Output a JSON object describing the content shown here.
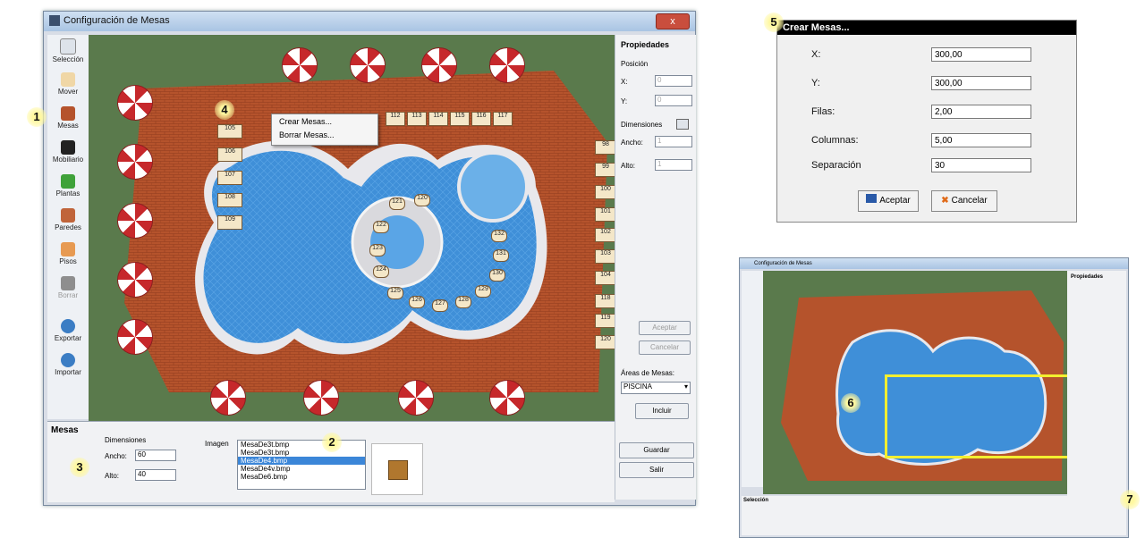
{
  "main_window": {
    "title": "Configuración de Mesas",
    "close_label": "x",
    "tools": [
      "Selección",
      "Mover",
      "Mesas",
      "Mobiliario",
      "Plantas",
      "Paredes",
      "Pisos",
      "Borrar",
      "Exportar",
      "Importar"
    ],
    "context_menu": [
      "Crear Mesas...",
      "Borrar Mesas..."
    ],
    "tables_top": [
      "112",
      "113",
      "114",
      "115",
      "116",
      "117"
    ],
    "tables_left": [
      "105",
      "106",
      "107",
      "108",
      "109"
    ],
    "tables_right": [
      "98",
      "99",
      "100",
      "101",
      "102",
      "103",
      "104",
      "118",
      "119",
      "120"
    ],
    "pool_tables": [
      "121",
      "120",
      "122",
      "123",
      "124",
      "125",
      "126",
      "127",
      "128",
      "129",
      "130",
      "131",
      "132"
    ],
    "properties": {
      "header": "Propiedades",
      "position_label": "Posición",
      "x_label": "X:",
      "x_value": "0",
      "y_label": "Y:",
      "y_value": "0",
      "dimensions_label": "Dimensiones",
      "width_label": "Ancho:",
      "width_value": "1",
      "height_label": "Alto:",
      "height_value": "1",
      "accept_label": "Aceptar",
      "cancel_label": "Cancelar",
      "areas_label": "Áreas de Mesas:",
      "area_selected": "PISCINA",
      "include_label": "Incluir",
      "save_label": "Guardar",
      "exit_label": "Salir"
    },
    "bottom_panel": {
      "title": "Mesas",
      "dimensions_label": "Dimensiones",
      "width_label": "Ancho:",
      "width_value": "60",
      "height_label": "Alto:",
      "height_value": "40",
      "image_label": "Imagen",
      "images": [
        "MesaDe3t.bmp",
        "MesaDe3t.bmp",
        "MesaDe4.bmp",
        "MesaDe4v.bmp",
        "MesaDe6.bmp"
      ],
      "selected_image_index": 2
    }
  },
  "badges": [
    "1",
    "2",
    "3",
    "4",
    "5",
    "6",
    "7"
  ],
  "dialog": {
    "title": "Crear Mesas...",
    "fields": [
      {
        "label": "X:",
        "value": "300,00"
      },
      {
        "label": "Y:",
        "value": "300,00"
      },
      {
        "label": "Filas:",
        "value": "2,00"
      },
      {
        "label": "Columnas:",
        "value": "5,00"
      },
      {
        "label": "Separación",
        "value": "30"
      }
    ],
    "accept_label": "Aceptar",
    "cancel_label": "Cancelar"
  },
  "thumbnail": {
    "title": "Configuración de Mesas",
    "bottom_title": "Selección",
    "properties_header": "Propiedades"
  },
  "colors": {
    "grass": "#5a7a4c",
    "brick": "#b5532c",
    "pool": "#3f8fd8",
    "highlight": "#f3ef2f"
  }
}
